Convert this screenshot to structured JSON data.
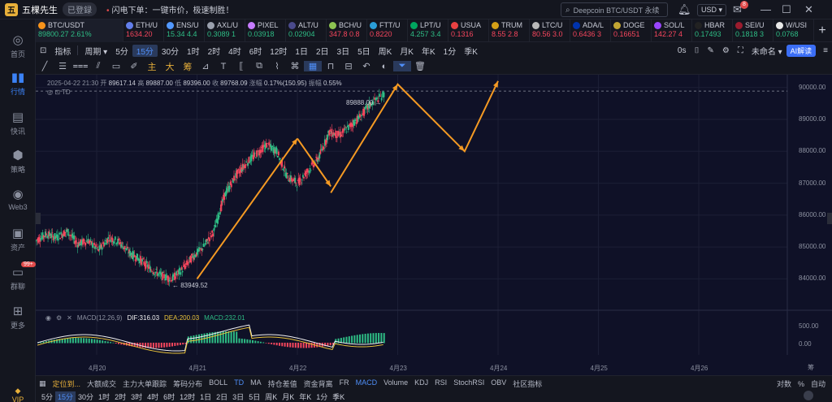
{
  "titlebar": {
    "app_name": "五棵先生",
    "login_badge": "已登録",
    "flash_text": "闪电下单：一键市价，极速制胜！",
    "search_text": "Deepcoin BTC/USDT 永续",
    "currency": "USD",
    "notification_count": "8"
  },
  "sidebar": {
    "items": [
      {
        "label": "首页",
        "icon": "compass-icon"
      },
      {
        "label": "行情",
        "icon": "chart-bars-icon"
      },
      {
        "label": "快讯",
        "icon": "news-icon"
      },
      {
        "label": "策略",
        "icon": "strategy-icon"
      },
      {
        "label": "Web3",
        "icon": "web3-icon"
      },
      {
        "label": "资产",
        "icon": "wallet-icon"
      },
      {
        "label": "群聊",
        "icon": "chat-icon"
      },
      {
        "label": "更多",
        "icon": "grid-icon"
      }
    ],
    "chat_badge": "99+",
    "vip_label": "VIP"
  },
  "tickers": [
    {
      "sym": "BTC/USDT",
      "price": "89800.27",
      "chg": "2.61%",
      "dir": "up",
      "color": "#f7931a"
    },
    {
      "sym": "ETH/U",
      "price": "1634.20",
      "chg": "",
      "dir": "down",
      "color": "#627eea"
    },
    {
      "sym": "ENS/U",
      "price": "15.34",
      "chg": "4.4",
      "dir": "up",
      "color": "#5298ff"
    },
    {
      "sym": "AXL/U",
      "price": "0.3089",
      "chg": "1",
      "dir": "up",
      "color": "#9aa0ad"
    },
    {
      "sym": "PIXEL",
      "price": "0.03918",
      "chg": "",
      "dir": "up",
      "color": "#c67bff"
    },
    {
      "sym": "ALT/U",
      "price": "0.02904",
      "chg": "",
      "dir": "up",
      "color": "#4a4a8c"
    },
    {
      "sym": "BCH/U",
      "price": "347.8",
      "chg": "0.8",
      "dir": "down",
      "color": "#8dc351"
    },
    {
      "sym": "FTT/U",
      "price": "0.8220",
      "chg": "",
      "dir": "down",
      "color": "#2a9ed8"
    },
    {
      "sym": "LPT/U",
      "price": "4.257",
      "chg": "3.4",
      "dir": "up",
      "color": "#00a55f"
    },
    {
      "sym": "USUA",
      "price": "0.1316",
      "chg": "",
      "dir": "down",
      "color": "#e84142"
    },
    {
      "sym": "TRUM",
      "price": "8.55",
      "chg": "2.8",
      "dir": "down",
      "color": "#d4a017"
    },
    {
      "sym": "LTC/U",
      "price": "80.56",
      "chg": "3.0",
      "dir": "down",
      "color": "#b8b8b8"
    },
    {
      "sym": "ADA/L",
      "price": "0.6436",
      "chg": "3",
      "dir": "down",
      "color": "#0033ad"
    },
    {
      "sym": "DOGE",
      "price": "0.16651",
      "chg": "",
      "dir": "down",
      "color": "#c2a633"
    },
    {
      "sym": "SOL/L",
      "price": "142.27",
      "chg": "4",
      "dir": "down",
      "color": "#9945ff"
    },
    {
      "sym": "HBAR",
      "price": "0.17493",
      "chg": "",
      "dir": "up",
      "color": "#222222"
    },
    {
      "sym": "SEI/U",
      "price": "0.1818",
      "chg": "3",
      "dir": "up",
      "color": "#9b1c2e"
    },
    {
      "sym": "W/USI",
      "price": "0.0768",
      "chg": "",
      "dir": "up",
      "color": "#e8e8e8"
    }
  ],
  "toolbar1": {
    "items": [
      "指标",
      "周期",
      "5分",
      "15分",
      "30分",
      "1时",
      "2时",
      "4时",
      "6时",
      "12时",
      "1日",
      "2日",
      "3日",
      "5日",
      "周K",
      "月K",
      "年K",
      "1分",
      "季K"
    ],
    "selected": "15分",
    "os_label": "0s",
    "layout_label": "未命名",
    "ai_label": "AI解读"
  },
  "toolbar2": {
    "cn_tools": [
      "主",
      "大",
      "筹"
    ]
  },
  "chart_header": {
    "date": "2025-04-22 21:30",
    "open_label": "开",
    "open": "89617.14",
    "high_label": "高",
    "high": "89887.00",
    "low_label": "低",
    "low": "89396.00",
    "close_label": "收",
    "close": "89768.09",
    "change_label": "涨幅",
    "change": "0.17%(150.95)",
    "amp_label": "振幅",
    "amp": "0.55%",
    "sub": "TD"
  },
  "chart_labels": {
    "high_marker": "89888.00 →",
    "low_marker": "← 83949.52",
    "macd_name": "MACD(12,26,9)",
    "dif": "DIF:316.03",
    "dea": "DEA:200.03",
    "macd_val": "MACD:232.01",
    "corner": "筹"
  },
  "chart_data": {
    "type": "line",
    "title": "",
    "xlabel": "",
    "ylabel": "",
    "x_ticks": [
      "4月20",
      "4月21",
      "4月22",
      "4月23",
      "4月24",
      "4月25",
      "4月26"
    ],
    "y_ticks": [
      "90000.00",
      "89000.00",
      "88000.00",
      "87000.00",
      "86000.00",
      "85000.00",
      "84000.00"
    ],
    "ylim": [
      83400,
      90400
    ],
    "macd_ticks": [
      "500.00",
      "0.00"
    ],
    "series": [
      {
        "values_note": "",
        "x": [
          0,
          0.03,
          0.06,
          0.09,
          0.12,
          0.15,
          0.18,
          0.21,
          0.24,
          0.27,
          0.3,
          0.33,
          0.36,
          0.39,
          0.42,
          0.45,
          0.48,
          0.51,
          0.54,
          0.57,
          0.6,
          0.63,
          0.66,
          0.69,
          0.72,
          0.75,
          0.78,
          0.81,
          0.84,
          0.87,
          0.9,
          0.93,
          0.96,
          1.0
        ],
        "values": [
          85200,
          85400,
          85300,
          85500,
          85100,
          85200,
          84900,
          85300,
          85150,
          84800,
          84600,
          84300,
          84100,
          84000,
          84300,
          84700,
          85000,
          85500,
          86600,
          87200,
          87600,
          87900,
          88200,
          88000,
          87200,
          87000,
          87400,
          87800,
          88600,
          88500,
          88800,
          89100,
          89500,
          89800
        ]
      }
    ],
    "annotations": [
      {
        "type": "arrow",
        "from": {
          "date": "4月21 00:00",
          "price": 84000
        },
        "to": {
          "date": "4月22 00:00",
          "price": 88400
        }
      },
      {
        "type": "arrow",
        "from": {
          "date": "4月22 00:00",
          "price": 88400
        },
        "to": {
          "date": "4月22 08:00",
          "price": 86900
        }
      },
      {
        "type": "polyline",
        "points": [
          {
            "date": "4月22 08:00",
            "price": 86700
          },
          {
            "date": "4月23 00:00",
            "price": 90100
          },
          {
            "date": "4月23 16:00",
            "price": 88000
          },
          {
            "date": "4月24 00:00",
            "price": 90200
          }
        ]
      }
    ]
  },
  "indicators": {
    "favorite": "定位到...",
    "items": [
      "大额成交",
      "主力大单跟踪",
      "筹码分布",
      "BOLL",
      "TD",
      "MA",
      "持仓差值",
      "资金背离",
      "FR",
      "MACD",
      "Volume",
      "KDJ",
      "RSI",
      "StochRSI",
      "OBV",
      "社区指标"
    ],
    "selected": [
      "TD",
      "MACD"
    ],
    "right_items": [
      "对数",
      "%",
      "自动"
    ]
  },
  "periods": {
    "items": [
      "5分",
      "15分",
      "30分",
      "1时",
      "2时",
      "3时",
      "4时",
      "6时",
      "12时",
      "1日",
      "2日",
      "3日",
      "5日",
      "周K",
      "月K",
      "年K",
      "1分",
      "季K"
    ],
    "selected": "15分"
  },
  "colors": {
    "up": "#2ebd85",
    "down": "#f6465d",
    "accent": "#3b82f6",
    "arrow": "#f59a23",
    "dif_line": "#f0f0f0",
    "dea_line": "#e8c23a"
  }
}
